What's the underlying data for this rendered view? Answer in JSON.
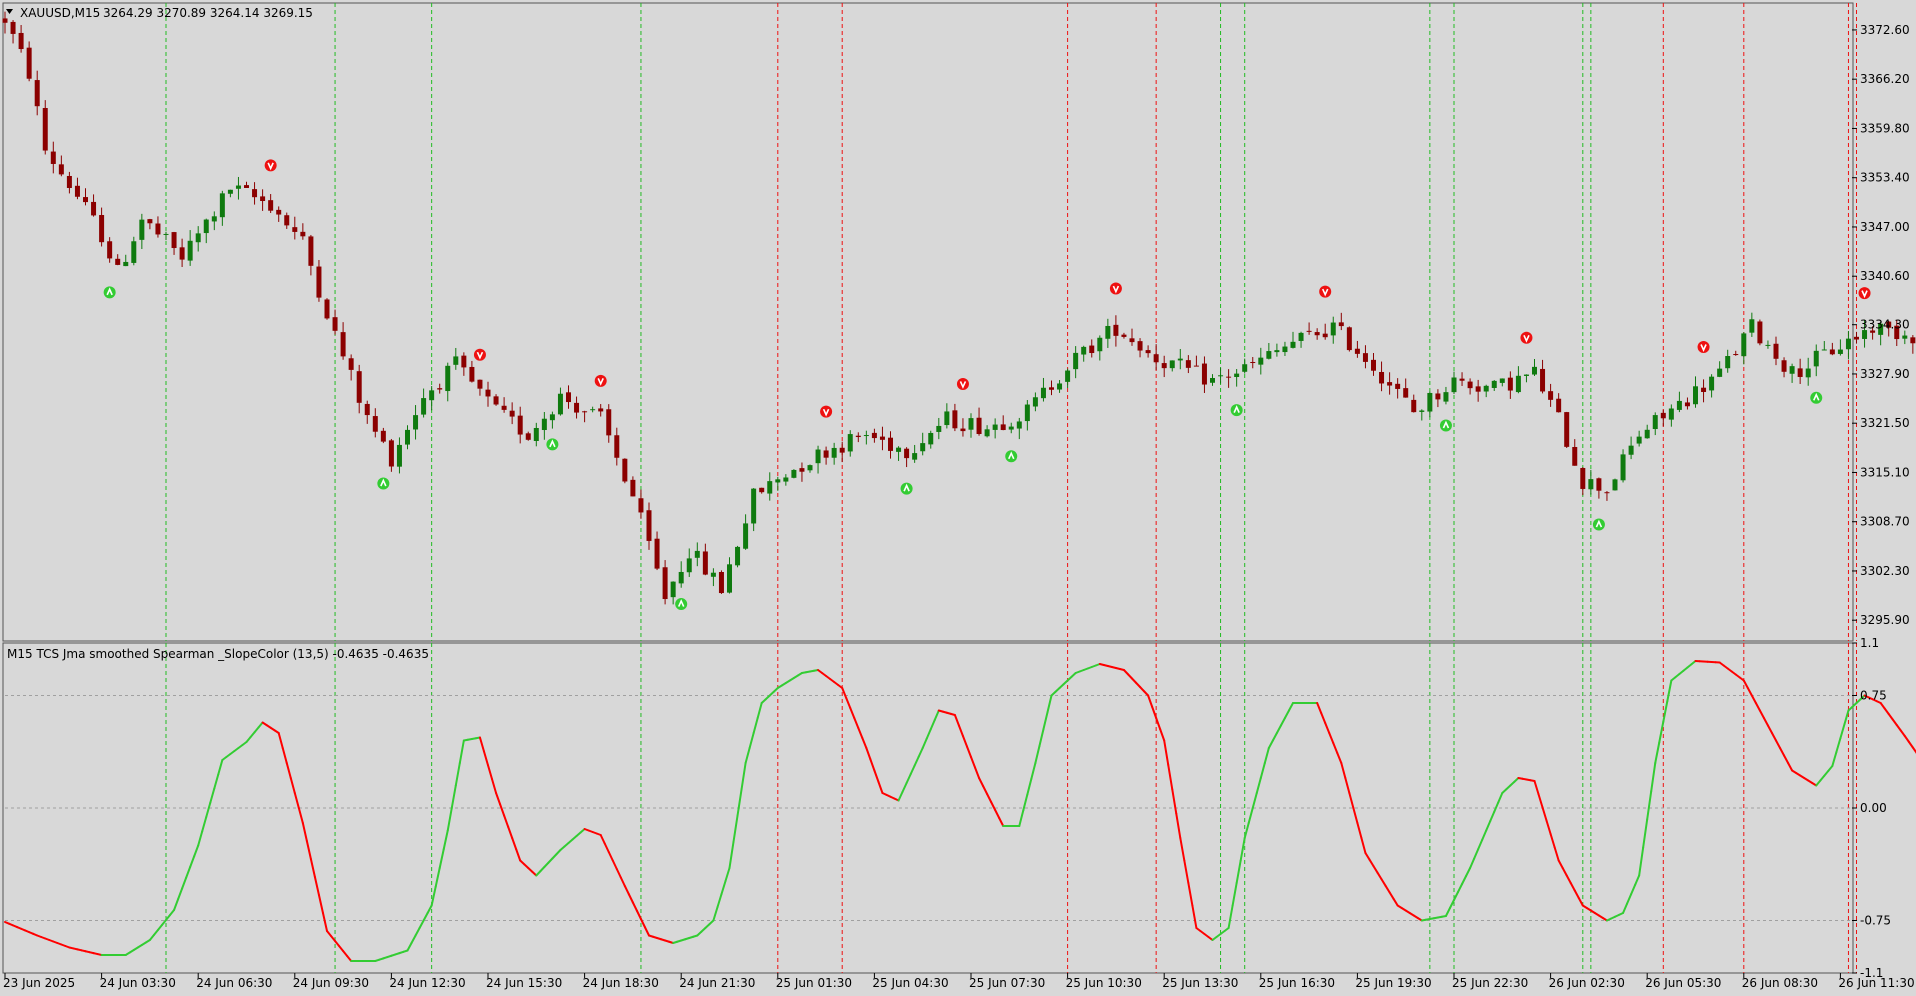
{
  "main_header": {
    "symbol": "XAUUSD,M15",
    "ohlc": "3264.29 3270.89 3264.14 3269.15"
  },
  "indicator_header": "M15 TCS Jma smoothed Spearman _SlopeColor (13,5) -0.4635 -0.4635",
  "colors": {
    "background": "#d8d8d8",
    "bull_candle": "#0f7a0f",
    "bear_candle": "#8b0000",
    "up_line": "#33cc33",
    "down_line": "#ff0000",
    "buy_vline": "#22bb22",
    "sell_vline": "#ee1111",
    "grid": "#a0a0a0"
  },
  "chart_data": [
    {
      "type": "candlestick",
      "title": "XAUUSD,M15",
      "symbol": "XAUUSD",
      "timeframe": "M15",
      "ylim": [
        3293.2,
        3376.1
      ],
      "price_ticks": [
        "3372.60",
        "3366.20",
        "3359.80",
        "3353.40",
        "3347.00",
        "3340.60",
        "3334.30",
        "3327.90",
        "3321.50",
        "3315.10",
        "3308.70",
        "3302.30",
        "3295.90"
      ],
      "current_price": "3340.60",
      "x_labels": [
        "23 Jun 2025",
        "24 Jun 03:30",
        "24 Jun 06:30",
        "24 Jun 09:30",
        "24 Jun 12:30",
        "24 Jun 15:30",
        "24 Jun 18:30",
        "24 Jun 21:30",
        "25 Jun 01:30",
        "25 Jun 04:30",
        "25 Jun 07:30",
        "25 Jun 10:30",
        "25 Jun 13:30",
        "25 Jun 16:30",
        "25 Jun 19:30",
        "25 Jun 22:30",
        "26 Jun 02:30",
        "26 Jun 05:30",
        "26 Jun 08:30",
        "26 Jun 11:30"
      ],
      "bars_per_label": 12,
      "anchors": [
        {
          "i": 0,
          "p": 3374.0
        },
        {
          "i": 3,
          "p": 3367.0
        },
        {
          "i": 5,
          "p": 3357.0
        },
        {
          "i": 9,
          "p": 3351.0
        },
        {
          "i": 12,
          "p": 3346.0
        },
        {
          "i": 14,
          "p": 3341.0
        },
        {
          "i": 17,
          "p": 3348.0
        },
        {
          "i": 22,
          "p": 3343.0
        },
        {
          "i": 28,
          "p": 3352.0
        },
        {
          "i": 33,
          "p": 3350.0
        },
        {
          "i": 37,
          "p": 3345.0
        },
        {
          "i": 41,
          "p": 3333.0
        },
        {
          "i": 45,
          "p": 3322.0
        },
        {
          "i": 48,
          "p": 3317.0
        },
        {
          "i": 52,
          "p": 3325.0
        },
        {
          "i": 56,
          "p": 3329.0
        },
        {
          "i": 61,
          "p": 3323.0
        },
        {
          "i": 65,
          "p": 3320.0
        },
        {
          "i": 69,
          "p": 3325.0
        },
        {
          "i": 74,
          "p": 3322.0
        },
        {
          "i": 78,
          "p": 3312.0
        },
        {
          "i": 82,
          "p": 3299.0
        },
        {
          "i": 85,
          "p": 3305.0
        },
        {
          "i": 89,
          "p": 3300.0
        },
        {
          "i": 93,
          "p": 3312.0
        },
        {
          "i": 97,
          "p": 3315.0
        },
        {
          "i": 102,
          "p": 3318.0
        },
        {
          "i": 107,
          "p": 3320.0
        },
        {
          "i": 112,
          "p": 3318.0
        },
        {
          "i": 117,
          "p": 3322.0
        },
        {
          "i": 122,
          "p": 3321.0
        },
        {
          "i": 127,
          "p": 3323.0
        },
        {
          "i": 132,
          "p": 3329.0
        },
        {
          "i": 138,
          "p": 3334.0
        },
        {
          "i": 143,
          "p": 3330.0
        },
        {
          "i": 150,
          "p": 3327.0
        },
        {
          "i": 155,
          "p": 3329.0
        },
        {
          "i": 160,
          "p": 3332.0
        },
        {
          "i": 165,
          "p": 3334.0
        },
        {
          "i": 170,
          "p": 3329.0
        },
        {
          "i": 175,
          "p": 3323.0
        },
        {
          "i": 180,
          "p": 3327.0
        },
        {
          "i": 185,
          "p": 3326.0
        },
        {
          "i": 190,
          "p": 3328.0
        },
        {
          "i": 193,
          "p": 3322.0
        },
        {
          "i": 196,
          "p": 3314.0
        },
        {
          "i": 199,
          "p": 3313.0
        },
        {
          "i": 203,
          "p": 3320.0
        },
        {
          "i": 208,
          "p": 3324.0
        },
        {
          "i": 213,
          "p": 3328.0
        },
        {
          "i": 217,
          "p": 3334.0
        },
        {
          "i": 222,
          "p": 3328.0
        },
        {
          "i": 227,
          "p": 3331.0
        },
        {
          "i": 232,
          "p": 3334.0
        },
        {
          "i": 237,
          "p": 3333.0
        },
        {
          "i": 243,
          "p": 3336.0
        },
        {
          "i": 248,
          "p": 3333.0
        },
        {
          "i": 252,
          "p": 3330.0
        },
        {
          "i": 256,
          "p": 3337.0
        },
        {
          "i": 261,
          "p": 3339.0
        },
        {
          "i": 266,
          "p": 3335.0
        },
        {
          "i": 270,
          "p": 3334.0
        },
        {
          "i": 273,
          "p": 3333.0
        },
        {
          "i": 277,
          "p": 3343.0
        },
        {
          "i": 282,
          "p": 3346.0
        },
        {
          "i": 286,
          "p": 3348.0
        },
        {
          "i": 288,
          "p": 3340.0
        }
      ],
      "signals": [
        {
          "i": 0,
          "dir": "sell"
        },
        {
          "i": 13,
          "dir": "buy"
        },
        {
          "i": 33,
          "dir": "sell"
        },
        {
          "i": 47,
          "dir": "buy"
        },
        {
          "i": 59,
          "dir": "sell"
        },
        {
          "i": 68,
          "dir": "buy"
        },
        {
          "i": 74,
          "dir": "sell"
        },
        {
          "i": 84,
          "dir": "buy"
        },
        {
          "i": 102,
          "dir": "sell"
        },
        {
          "i": 112,
          "dir": "buy"
        },
        {
          "i": 119,
          "dir": "sell"
        },
        {
          "i": 125,
          "dir": "buy"
        },
        {
          "i": 138,
          "dir": "sell"
        },
        {
          "i": 153,
          "dir": "buy"
        },
        {
          "i": 164,
          "dir": "sell"
        },
        {
          "i": 179,
          "dir": "buy"
        },
        {
          "i": 189,
          "dir": "sell"
        },
        {
          "i": 198,
          "dir": "buy"
        },
        {
          "i": 211,
          "dir": "sell"
        },
        {
          "i": 225,
          "dir": "buy"
        },
        {
          "i": 231,
          "dir": "sell"
        },
        {
          "i": 240,
          "dir": "buy"
        },
        {
          "i": 245,
          "dir": "sell"
        },
        {
          "i": 254,
          "dir": "buy"
        },
        {
          "i": 262,
          "dir": "sell"
        },
        {
          "i": 272,
          "dir": "buy"
        },
        {
          "i": 285,
          "dir": "sell"
        }
      ],
      "buy_vlines": [
        20,
        41,
        53,
        79,
        151,
        154,
        177,
        180,
        196,
        197,
        252,
        254,
        271,
        273
      ],
      "sell_vlines": [
        96,
        104,
        132,
        143,
        206,
        216,
        229,
        230,
        280
      ]
    },
    {
      "type": "line",
      "title": "M15 TCS Jma smoothed Spearman _SlopeColor (13,5)",
      "ylim": [
        -1.1,
        1.1
      ],
      "y_ticks": [
        "1.1",
        "0.75",
        "0.00",
        "-0.75",
        "-1.1"
      ],
      "guide_levels": [
        0.75,
        0.0,
        -0.75
      ],
      "series": [
        {
          "values_at": [
            {
              "i": 0,
              "v": -0.76
            },
            {
              "i": 4,
              "v": -0.85
            },
            {
              "i": 8,
              "v": -0.93
            },
            {
              "i": 12,
              "v": -0.98
            },
            {
              "i": 15,
              "v": -0.98
            },
            {
              "i": 18,
              "v": -0.88
            },
            {
              "i": 21,
              "v": -0.68
            },
            {
              "i": 24,
              "v": -0.25
            },
            {
              "i": 27,
              "v": 0.32
            },
            {
              "i": 30,
              "v": 0.44
            },
            {
              "i": 32,
              "v": 0.57
            },
            {
              "i": 34,
              "v": 0.5
            },
            {
              "i": 37,
              "v": -0.1
            },
            {
              "i": 40,
              "v": -0.82
            },
            {
              "i": 43,
              "v": -1.02
            },
            {
              "i": 46,
              "v": -1.02
            },
            {
              "i": 50,
              "v": -0.95
            },
            {
              "i": 53,
              "v": -0.65
            },
            {
              "i": 55,
              "v": -0.15
            },
            {
              "i": 57,
              "v": 0.45
            },
            {
              "i": 59,
              "v": 0.47
            },
            {
              "i": 61,
              "v": 0.1
            },
            {
              "i": 64,
              "v": -0.35
            },
            {
              "i": 66,
              "v": -0.45
            },
            {
              "i": 69,
              "v": -0.28
            },
            {
              "i": 72,
              "v": -0.14
            },
            {
              "i": 74,
              "v": -0.18
            },
            {
              "i": 77,
              "v": -0.52
            },
            {
              "i": 80,
              "v": -0.85
            },
            {
              "i": 83,
              "v": -0.9
            },
            {
              "i": 86,
              "v": -0.85
            },
            {
              "i": 88,
              "v": -0.75
            },
            {
              "i": 90,
              "v": -0.4
            },
            {
              "i": 92,
              "v": 0.3
            },
            {
              "i": 94,
              "v": 0.7
            },
            {
              "i": 96,
              "v": 0.8
            },
            {
              "i": 99,
              "v": 0.9
            },
            {
              "i": 101,
              "v": 0.92
            },
            {
              "i": 104,
              "v": 0.8
            },
            {
              "i": 107,
              "v": 0.4
            },
            {
              "i": 109,
              "v": 0.1
            },
            {
              "i": 111,
              "v": 0.05
            },
            {
              "i": 114,
              "v": 0.4
            },
            {
              "i": 116,
              "v": 0.65
            },
            {
              "i": 118,
              "v": 0.62
            },
            {
              "i": 121,
              "v": 0.2
            },
            {
              "i": 124,
              "v": -0.12
            },
            {
              "i": 126,
              "v": -0.12
            },
            {
              "i": 128,
              "v": 0.3
            },
            {
              "i": 130,
              "v": 0.75
            },
            {
              "i": 133,
              "v": 0.9
            },
            {
              "i": 136,
              "v": 0.96
            },
            {
              "i": 139,
              "v": 0.92
            },
            {
              "i": 142,
              "v": 0.75
            },
            {
              "i": 144,
              "v": 0.45
            },
            {
              "i": 146,
              "v": -0.2
            },
            {
              "i": 148,
              "v": -0.8
            },
            {
              "i": 150,
              "v": -0.88
            },
            {
              "i": 152,
              "v": -0.8
            },
            {
              "i": 154,
              "v": -0.2
            },
            {
              "i": 157,
              "v": 0.4
            },
            {
              "i": 160,
              "v": 0.7
            },
            {
              "i": 163,
              "v": 0.7
            },
            {
              "i": 166,
              "v": 0.3
            },
            {
              "i": 169,
              "v": -0.3
            },
            {
              "i": 173,
              "v": -0.65
            },
            {
              "i": 176,
              "v": -0.75
            },
            {
              "i": 179,
              "v": -0.72
            },
            {
              "i": 182,
              "v": -0.4
            },
            {
              "i": 186,
              "v": 0.1
            },
            {
              "i": 188,
              "v": 0.2
            },
            {
              "i": 190,
              "v": 0.18
            },
            {
              "i": 193,
              "v": -0.35
            },
            {
              "i": 196,
              "v": -0.65
            },
            {
              "i": 199,
              "v": -0.75
            },
            {
              "i": 201,
              "v": -0.7
            },
            {
              "i": 203,
              "v": -0.45
            },
            {
              "i": 205,
              "v": 0.3
            },
            {
              "i": 207,
              "v": 0.85
            },
            {
              "i": 210,
              "v": 0.98
            },
            {
              "i": 213,
              "v": 0.97
            },
            {
              "i": 216,
              "v": 0.85
            },
            {
              "i": 219,
              "v": 0.55
            },
            {
              "i": 222,
              "v": 0.25
            },
            {
              "i": 225,
              "v": 0.15
            },
            {
              "i": 227,
              "v": 0.28
            },
            {
              "i": 229,
              "v": 0.65
            },
            {
              "i": 231,
              "v": 0.75
            },
            {
              "i": 233,
              "v": 0.7
            },
            {
              "i": 236,
              "v": 0.48
            },
            {
              "i": 239,
              "v": 0.25
            },
            {
              "i": 241,
              "v": 0.3
            },
            {
              "i": 243,
              "v": 0.55
            },
            {
              "i": 245,
              "v": 0.65
            },
            {
              "i": 247,
              "v": 0.62
            },
            {
              "i": 249,
              "v": 0.2
            },
            {
              "i": 251,
              "v": -0.45
            },
            {
              "i": 253,
              "v": -0.78
            },
            {
              "i": 255,
              "v": -0.82
            },
            {
              "i": 257,
              "v": -0.6
            },
            {
              "i": 259,
              "v": 0.1
            },
            {
              "i": 261,
              "v": 0.5
            },
            {
              "i": 264,
              "v": 0.66
            },
            {
              "i": 266,
              "v": 0.6
            },
            {
              "i": 269,
              "v": 0.1
            },
            {
              "i": 271,
              "v": -0.55
            },
            {
              "i": 273,
              "v": -0.85
            },
            {
              "i": 275,
              "v": -0.88
            },
            {
              "i": 277,
              "v": -0.7
            },
            {
              "i": 279,
              "v": 0.05
            },
            {
              "i": 281,
              "v": 0.75
            },
            {
              "i": 283,
              "v": 0.86
            },
            {
              "i": 286,
              "v": 0.92
            },
            {
              "i": 288,
              "v": 0.8
            }
          ]
        }
      ]
    }
  ]
}
